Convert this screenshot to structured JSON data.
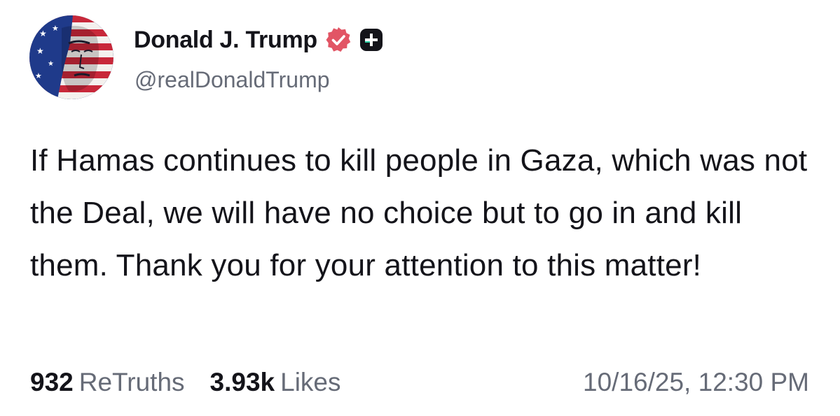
{
  "author": {
    "display_name": "Donald J. Trump",
    "handle": "@realDonaldTrump",
    "badge_icon": "verified-badge-icon",
    "badge_color": "#e25565",
    "plus_icon": "plus-box-icon"
  },
  "post": {
    "text": "If Hamas continues to kill people in Gaza, which was not the Deal, we will have no choice but to go in and kill them. Thank you for your attention to this matter!"
  },
  "stats": {
    "retruths_count": "932",
    "retruths_label": "ReTruths",
    "likes_count": "3.93k",
    "likes_label": "Likes"
  },
  "timestamp": "10/16/25, 12:30 PM",
  "colors": {
    "text_primary": "#14141a",
    "text_secondary": "#666b77",
    "background": "#ffffff"
  }
}
